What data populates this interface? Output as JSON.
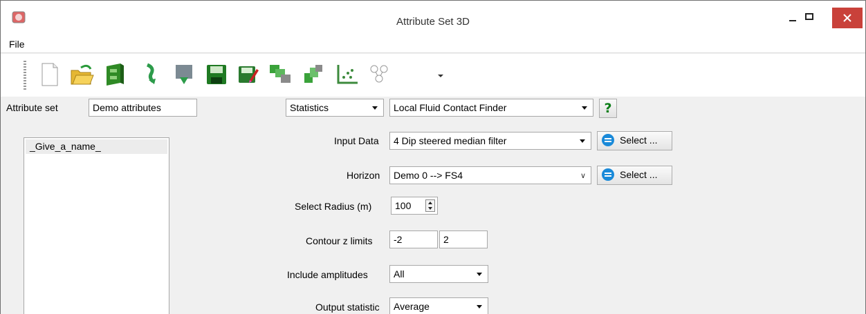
{
  "window": {
    "title": "Attribute Set 3D"
  },
  "menu": {
    "file": "File"
  },
  "toolbar": {
    "icons": [
      "new-icon",
      "open-icon",
      "cabinet-icon",
      "import-icon",
      "reload-icon",
      "save-icon",
      "save-as-icon",
      "attribute-icon-1",
      "attribute-icon-2",
      "crossplot-icon",
      "tree-icon"
    ]
  },
  "attribute_set": {
    "label": "Attribute set",
    "value": "Demo attributes"
  },
  "category_combo": {
    "value": "Statistics"
  },
  "attribute_combo": {
    "value": "Local Fluid Contact Finder"
  },
  "help": {
    "label": "?"
  },
  "attr_list": {
    "items": [
      "_Give_a_name_"
    ]
  },
  "input_data": {
    "label": "Input Data",
    "value": "4 Dip steered median filter",
    "select_label": "Select ..."
  },
  "horizon": {
    "label": "Horizon",
    "value": "Demo 0 --> FS4",
    "select_label": "Select ..."
  },
  "radius": {
    "label": "Select Radius (m)",
    "value": "100"
  },
  "contour": {
    "label": "Contour z limits",
    "min": "-2",
    "max": "2"
  },
  "amplitudes": {
    "label": "Include amplitudes",
    "value": "All"
  },
  "output_stat": {
    "label": "Output statistic",
    "value": "Average"
  },
  "colors": {
    "close_button": "#c9413a",
    "select_icon": "#1a8ad9",
    "help_icon": "#0a7d17"
  }
}
